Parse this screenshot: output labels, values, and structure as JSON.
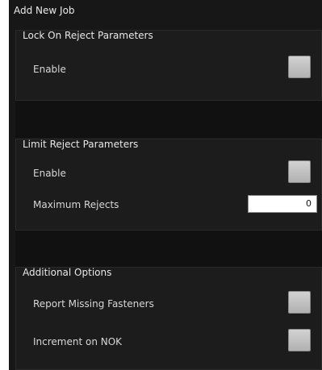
{
  "window": {
    "title": "Add New Job"
  },
  "lock_on_reject": {
    "title": "Lock On Reject Parameters",
    "enable_label": "Enable"
  },
  "limit_reject": {
    "title": "Limit Reject Parameters",
    "enable_label": "Enable",
    "maximum_rejects_label": "Maximum Rejects",
    "maximum_rejects_value": "0"
  },
  "additional_options": {
    "title": "Additional Options",
    "report_missing_label": "Report Missing Fasteners",
    "increment_nok_label": "Increment on NOK"
  }
}
